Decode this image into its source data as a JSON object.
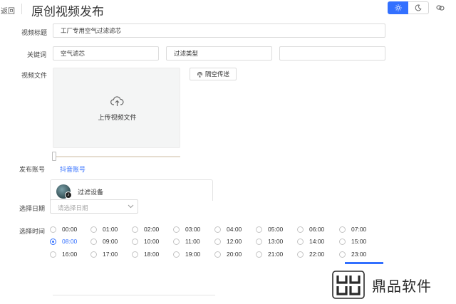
{
  "header": {
    "back_label": "返回",
    "title": "原创视频发布",
    "theme": {
      "light_icon": "sun-icon",
      "dark_icon": "moon-icon",
      "active": "light",
      "accent": "#3370ff"
    },
    "link_icon": "link-icon"
  },
  "form": {
    "video_title": {
      "label": "视频标题",
      "value": "工厂专用空气过滤滤芯"
    },
    "keywords": {
      "label": "关键词",
      "values": [
        "空气滤芯",
        "过滤类型",
        ""
      ]
    },
    "video_file": {
      "label": "视频文件",
      "upload_icon": "cloud-upload-icon",
      "upload_text": "上传视频文件",
      "transfer_label": "隔空传送",
      "transfer_icon": "airdrop-icon"
    },
    "account": {
      "label": "发布账号",
      "tab": "抖音账号",
      "name": "过滤设备",
      "badge_icon": "douyin-icon"
    },
    "date": {
      "label": "选择日期",
      "placeholder": "请选择日期",
      "chevron_icon": "chevron-down-icon"
    },
    "time": {
      "label": "选择时间",
      "selected": "08:00",
      "options": [
        "00:00",
        "01:00",
        "02:00",
        "03:00",
        "04:00",
        "05:00",
        "06:00",
        "07:00",
        "08:00",
        "09:00",
        "10:00",
        "11:00",
        "12:00",
        "13:00",
        "14:00",
        "15:00",
        "16:00",
        "17:00",
        "18:00",
        "19:00",
        "20:00",
        "21:00",
        "22:00",
        "23:00"
      ]
    }
  },
  "watermark": {
    "text": "鼎品软件",
    "icon": "dingpin-logo-icon"
  }
}
